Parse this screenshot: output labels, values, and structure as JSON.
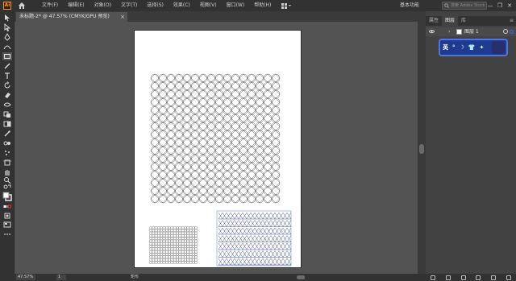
{
  "app": {
    "logo_text": "Ai",
    "menu": [
      "文件(F)",
      "编辑(E)",
      "对象(O)",
      "文字(T)",
      "选择(S)",
      "效果(C)",
      "视图(V)",
      "窗口(W)",
      "帮助(H)"
    ],
    "workspace_label": "基本功能",
    "search_placeholder": "搜索 Adobe Stock",
    "window_controls": [
      "—",
      "❐",
      "✕"
    ]
  },
  "document": {
    "tab_title": "未标题-2* @ 47.57% (CMYK/GPU 预览)",
    "tab_close": "×"
  },
  "panel": {
    "tabs": [
      "属性",
      "图层",
      "库"
    ],
    "active_tab": "图层",
    "menu_icon": "≡",
    "layer": {
      "name": "图层 1",
      "chevron": "›"
    },
    "ime": {
      "items": [
        "英",
        "°",
        "☽",
        "👕",
        "✦"
      ]
    }
  },
  "status": {
    "zoom": "47.57%",
    "page": "1",
    "tool": "矩形"
  },
  "colors": {
    "accent": "#2b6cff",
    "brand": "#ff9a00",
    "pattern_blue": "#3a55b0"
  }
}
